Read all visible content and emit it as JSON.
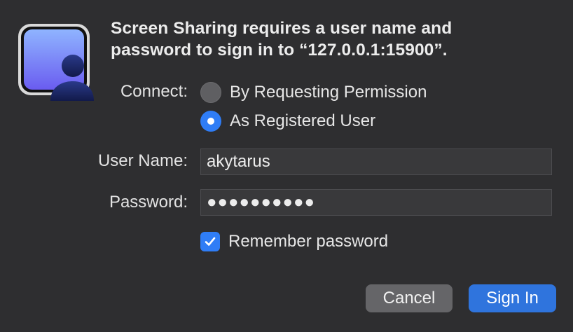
{
  "dialog": {
    "title_line1": "Screen Sharing requires a user name and",
    "title_line2": "password to sign in to “127.0.0.1:15900”.",
    "app_icon": "screen-sharing-icon"
  },
  "connect": {
    "label": "Connect:",
    "options": [
      {
        "label": "By Requesting Permission",
        "selected": false
      },
      {
        "label": "As Registered User",
        "selected": true
      }
    ]
  },
  "form": {
    "username_label": "User Name:",
    "username_value": "akytarus",
    "password_label": "Password:",
    "password_mask": "●●●●●●●●●●",
    "remember_label": "Remember password",
    "remember_checked": true
  },
  "buttons": {
    "cancel": "Cancel",
    "sign_in": "Sign In"
  },
  "colors": {
    "accent": "#2f7df6",
    "background": "#2e2e30",
    "field": "#39393b"
  }
}
